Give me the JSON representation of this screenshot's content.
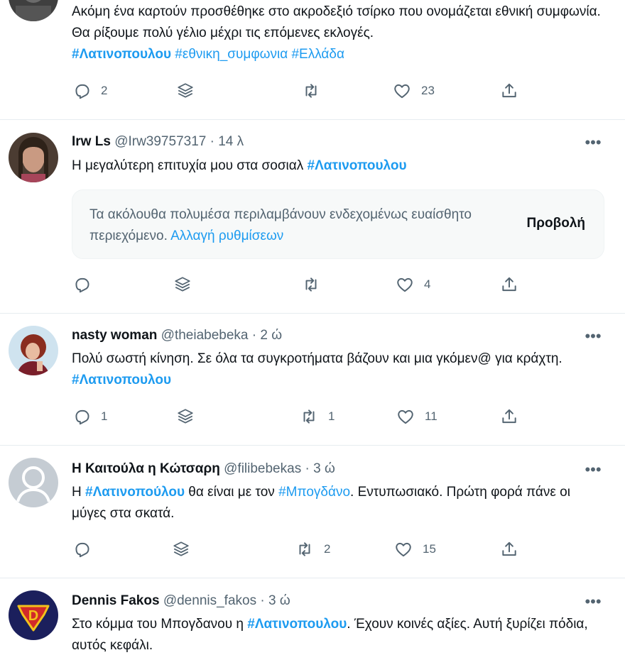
{
  "tweets": [
    {
      "id": "t0",
      "text_parts": [
        "Ακόμη ένα καρτούν προσθέθηκε στο ακροδεξιό τσίρκο που ονομάζεται εθνική συμφωνία. Θα ρίξουμε πολύ γέλιο μέχρι τις επόμενες εκλογές."
      ],
      "tags": [
        "#Λατινοπουλου",
        "#εθνικη_συμφωνια",
        "#Ελλάδα"
      ],
      "replies": "2",
      "retweets": "",
      "likes": "23"
    },
    {
      "id": "t1",
      "name": "Irw Ls",
      "handle": "@Irw39757317",
      "sep": "·",
      "time": "14 λ",
      "text": "Η μεγαλύτερη επιτυχία μου στα σοσιαλ ",
      "tag": "#Λατινοπουλου",
      "warning_text": "Τα ακόλουθα πολυμέσα περιλαμβάνουν ενδεχομένως ευαίσθητο περιεχόμενο.",
      "warning_link": "Αλλαγή ρυθμίσεων",
      "warning_button": "Προβολή",
      "replies": "",
      "retweets": "",
      "likes": "4"
    },
    {
      "id": "t2",
      "name": "nasty woman",
      "handle": "@theiabebeka",
      "sep": "·",
      "time": "2 ώ",
      "text": "Πολύ σωστή κίνηση. Σε όλα τα συγκροτήματα βάζουν και μια γκόμεν@ για κράχτη. ",
      "tag": "#Λατινοπουλου",
      "replies": "1",
      "retweets": "1",
      "likes": "11"
    },
    {
      "id": "t3",
      "name": "Η Καιτούλα η Κώτσαρη",
      "handle": "@filibebekas",
      "sep": "·",
      "time": "3 ώ",
      "text_a": "Η ",
      "tag_a": "#Λατινοπούλου",
      "text_b": " θα είναι με τον ",
      "tag_b": "#Μπογδάνο",
      "text_c": ". Εντυπωσιακό. Πρώτη φορά πάνε οι μύγες στα σκατά.",
      "replies": "",
      "retweets": "2",
      "likes": "15"
    },
    {
      "id": "t4",
      "name": "Dennis Fakos",
      "handle": "@dennis_fakos",
      "sep": "·",
      "time": "3 ώ",
      "text_a": "Στο κόμμα του Μπογδανου η ",
      "tag": "#Λατινοπουλου",
      "text_b": ". Έχουν κοινές αξίες. Αυτή ξυρίζει πόδια, αυτός κεφάλι."
    }
  ],
  "more_label": "•••",
  "icons": [
    "reply-icon",
    "layers-icon",
    "retweet-icon",
    "like-icon",
    "share-icon",
    "more-icon"
  ],
  "colors": {
    "link": "#1d9bf0",
    "muted": "#536471",
    "text": "#0f1419"
  }
}
